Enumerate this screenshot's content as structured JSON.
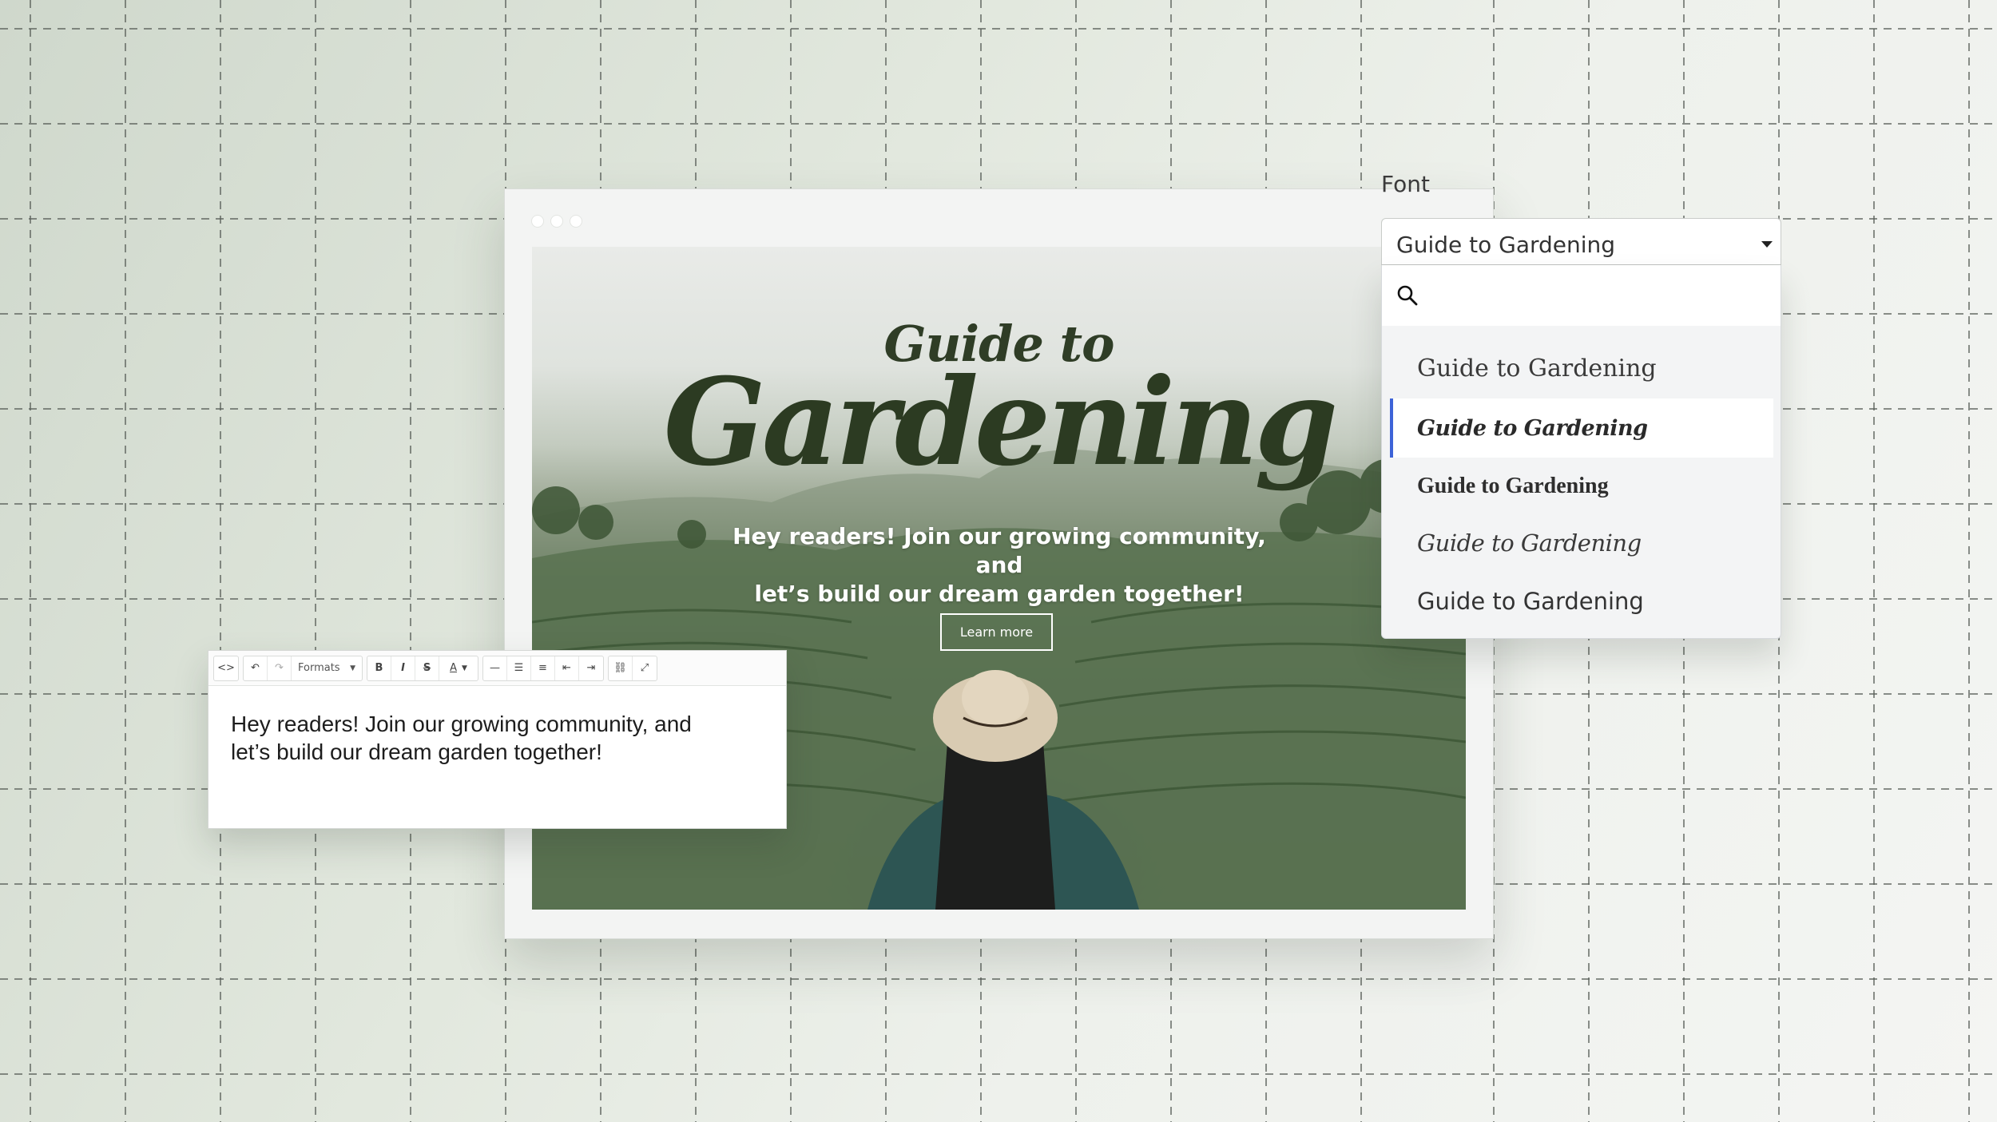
{
  "font_picker": {
    "label": "Font",
    "selected_value": "Guide to Gardening",
    "search_placeholder": "",
    "options": [
      "Guide to Gardening",
      "Guide to Gardening",
      "Guide to Gardening",
      "Guide to Gardening",
      "Guide to Gardening"
    ],
    "highlighted_index": 1,
    "accent_color": "#3d63d8"
  },
  "hero": {
    "kicker": "Guide to",
    "title": "Gardening",
    "subtitle_line1": "Hey readers! Join our growing community, and",
    "subtitle_line2": "let’s build our dream garden together!",
    "button_label": "Learn more",
    "title_color": "#2c3b22"
  },
  "editor": {
    "toolbar": {
      "formats_label": "Formats",
      "bold_label": "B",
      "italic_label": "I",
      "strike_label": "S",
      "color_label": "A"
    },
    "body_line1": "Hey readers! Join our growing community, and",
    "body_line2": "let’s build our dream garden together!"
  }
}
